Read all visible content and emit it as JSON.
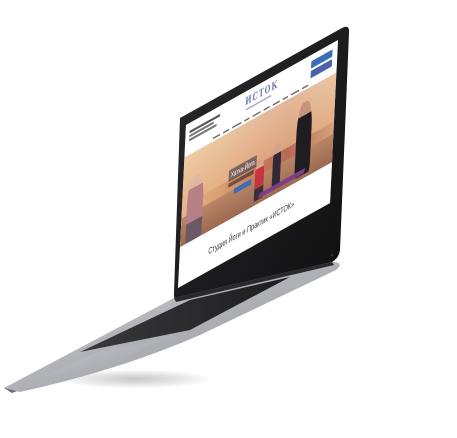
{
  "site": {
    "logo": "ИСТОК",
    "hero_heading": "Хатха-Йога",
    "section_title": "Студия Йоги и Практик «ИСТОК»"
  },
  "nav": {
    "items": [
      "",
      "",
      "",
      "",
      "",
      "",
      "",
      "",
      "",
      ""
    ]
  },
  "colors": {
    "accent": "#3d6db5",
    "logo": "#6a7bb0",
    "laptop_body": "#b7b8bc",
    "bezel": "#1c1c1e"
  }
}
